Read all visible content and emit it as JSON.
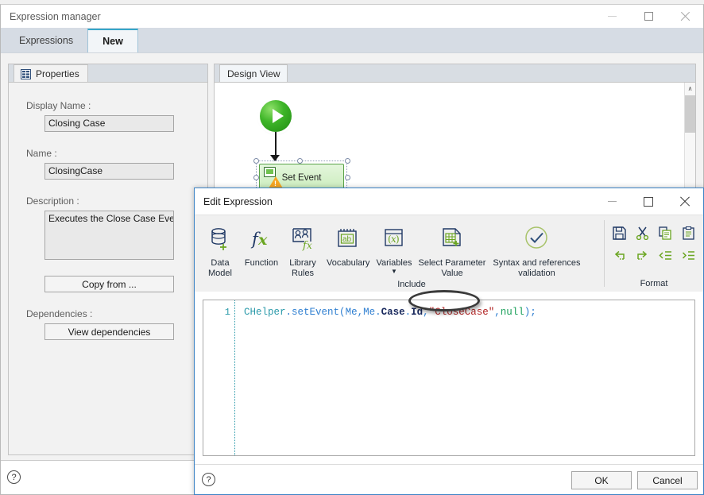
{
  "background": {
    "partial_text": ""
  },
  "main_window": {
    "title": "Expression manager",
    "window_controls": [
      {
        "name": "minimize",
        "glyph": "minimize-icon"
      },
      {
        "name": "maximize",
        "glyph": "maximize-icon"
      },
      {
        "name": "close",
        "glyph": "close-icon"
      }
    ],
    "tabs": [
      {
        "label": "Expressions",
        "active": false
      },
      {
        "label": "New",
        "active": true
      }
    ],
    "status_help": "?"
  },
  "properties": {
    "tab_label": "Properties",
    "tab_icon": "properties-icon",
    "fields": [
      {
        "label": "Display Name :",
        "value": "Closing Case"
      },
      {
        "label": "Name :",
        "value": "ClosingCase"
      },
      {
        "label": "Description :",
        "value": "Executes the Close Case Event"
      }
    ],
    "copy_from_label": "Copy from ...",
    "dependencies_label": "Dependencies :",
    "view_dependencies_label": "View dependencies"
  },
  "design_view": {
    "tab_label": "Design View",
    "start_node": "start-node",
    "node_label": "Set Event",
    "scrollbar": {
      "up_arrow": "∧"
    }
  },
  "dialog": {
    "title": "Edit Expression",
    "window_controls": [
      {
        "name": "minimize",
        "glyph": "minimize-icon"
      },
      {
        "name": "maximize",
        "glyph": "maximize-icon"
      },
      {
        "name": "close",
        "glyph": "close-icon"
      }
    ],
    "ribbon": {
      "buttons": [
        {
          "label": "Data\nModel",
          "line1": "Data",
          "line2": "Model",
          "icon": "data-model-icon"
        },
        {
          "label": "Function",
          "line1": "Function",
          "line2": "",
          "icon": "function-fx-icon"
        },
        {
          "label": "Library\nRules",
          "line1": "Library",
          "line2": "Rules",
          "icon": "library-rules-icon"
        },
        {
          "label": "Vocabulary",
          "line1": "Vocabulary",
          "line2": "",
          "icon": "vocabulary-icon"
        },
        {
          "label": "Variables",
          "line1": "Variables",
          "line2": "",
          "icon": "variables-icon",
          "has_caret": true
        },
        {
          "label": "Select Parameter\nValue",
          "line1": "Select Parameter",
          "line2": "Value",
          "icon": "select-parameter-value-icon"
        },
        {
          "label": "Syntax and references\nvalidation",
          "line1": "Syntax and references",
          "line2": "validation",
          "icon": "syntax-validation-icon"
        }
      ],
      "include_group_label": "Include",
      "format_group_label": "Format",
      "format_icons": [
        {
          "name": "save-icon"
        },
        {
          "name": "cut-icon"
        },
        {
          "name": "copy-icon"
        },
        {
          "name": "paste-icon"
        },
        {
          "name": "undo-icon"
        },
        {
          "name": "redo-icon"
        },
        {
          "name": "outdent-icon"
        },
        {
          "name": "indent-icon"
        }
      ]
    },
    "editor": {
      "line_number": "1",
      "code_tokens": [
        {
          "text": "CHelper",
          "cls": "tk-cls"
        },
        {
          "text": ".",
          "cls": "tk-punc"
        },
        {
          "text": "setEvent",
          "cls": "tk-fn"
        },
        {
          "text": "(",
          "cls": "tk-punc"
        },
        {
          "text": "Me",
          "cls": "tk-plain"
        },
        {
          "text": ",",
          "cls": "tk-punc"
        },
        {
          "text": "Me",
          "cls": "tk-plain"
        },
        {
          "text": ".",
          "cls": "tk-punc"
        },
        {
          "text": "Case",
          "cls": "tk-id"
        },
        {
          "text": ".",
          "cls": "tk-punc"
        },
        {
          "text": "Id",
          "cls": "tk-id"
        },
        {
          "text": ",",
          "cls": "tk-punc"
        },
        {
          "text": "\"CloseCase\"",
          "cls": "tk-str"
        },
        {
          "text": ",",
          "cls": "tk-punc"
        },
        {
          "text": "null",
          "cls": "tk-kw"
        },
        {
          "text": ")",
          "cls": "tk-punc"
        },
        {
          "text": ";",
          "cls": "tk-punc"
        }
      ],
      "full_code": "CHelper.setEvent(Me,Me.Case.Id,\"CloseCase\",null);",
      "annotation": "ellipse-highlight-around-CloseCase"
    },
    "footer": {
      "help": "?",
      "ok_label": "OK",
      "cancel_label": "Cancel"
    }
  },
  "colors": {
    "accent_tab": "#36a6c9",
    "dialog_border": "#3d84c6",
    "ribbon_icon_navy": "#1f3864",
    "ribbon_icon_green": "#6aa521",
    "node_green": "#5aa349",
    "string_red": "#b02020",
    "keyword_green": "#1aa05a"
  }
}
